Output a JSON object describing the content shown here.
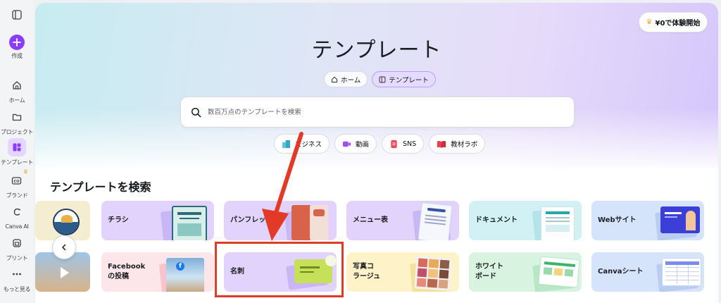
{
  "sidebar": {
    "items": [
      {
        "label": "",
        "icon": "sidebar-toggle-icon"
      },
      {
        "label": "作成",
        "icon": "plus-icon"
      },
      {
        "label": "ホーム",
        "icon": "home-icon"
      },
      {
        "label": "プロジェクト",
        "icon": "folder-icon"
      },
      {
        "label": "テンプレート",
        "icon": "template-icon"
      },
      {
        "label": "ブランド",
        "icon": "brand-icon"
      },
      {
        "label": "Canva AI",
        "icon": "canva-ai-icon"
      },
      {
        "label": "プリント",
        "icon": "print-icon"
      },
      {
        "label": "もっと見る",
        "icon": "more-icon"
      }
    ]
  },
  "header": {
    "trial_label": "¥0で体験開始",
    "title": "テンプレート"
  },
  "breadcrumb": [
    {
      "label": "ホーム",
      "icon": "home-icon"
    },
    {
      "label": "テンプレート",
      "icon": "template-icon"
    }
  ],
  "search": {
    "placeholder": "数百万点のテンプレートを検索"
  },
  "chips": [
    {
      "label": "ビジネス",
      "icon": "business-icon"
    },
    {
      "label": "動画",
      "icon": "video-icon"
    },
    {
      "label": "SNS",
      "icon": "sns-icon"
    },
    {
      "label": "教材ラボ",
      "icon": "book-icon"
    }
  ],
  "section": {
    "title": "テンプレートを検索"
  },
  "cards_row1": [
    {
      "label": "チラシ"
    },
    {
      "label": "パンフレット"
    },
    {
      "label": "メニュー表"
    },
    {
      "label": "ドキュメント"
    },
    {
      "label": "Webサイト"
    }
  ],
  "cards_row2": [
    {
      "label": "Facebook\nの投稿"
    },
    {
      "label": "名刺"
    },
    {
      "label": "写真コ\nラージュ"
    },
    {
      "label": "ホワイト\nボード"
    },
    {
      "label": "Canvaシート"
    }
  ],
  "colors": {
    "accent": "#8b3dff",
    "highlight": "#e33a27"
  }
}
